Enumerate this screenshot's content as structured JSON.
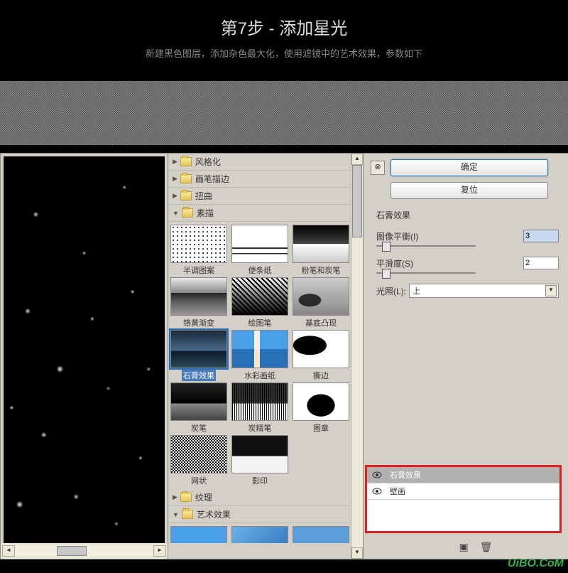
{
  "tutorial": {
    "title": "第7步 - 添加星光",
    "description": "新建黑色图层，添加杂色最大化，使用滤镜中的艺术效果，参数如下"
  },
  "dialog": {
    "ok": "确定",
    "reset": "复位",
    "effect_name": "石膏效果",
    "params": {
      "balance_label": "图像平衡(I)",
      "balance_value": "3",
      "smooth_label": "平滑度(S)",
      "smooth_value": "2",
      "light_label": "光照(L):",
      "light_value": "上"
    }
  },
  "categories": {
    "stylize": "风格化",
    "brush": "画笔描边",
    "distort": "扭曲",
    "sketch": "素描",
    "texture": "纹理",
    "artistic": "艺术效果"
  },
  "thumbs": {
    "halftone": "半调图案",
    "note": "便条纸",
    "chalk": "粉笔和炭笔",
    "chrome": "铬黄渐变",
    "pen": "绘图笔",
    "relief": "基底凸现",
    "plaster": "石膏效果",
    "water": "水彩画纸",
    "torn": "撕边",
    "charcoal": "炭笔",
    "conte": "炭精笔",
    "stamp": "图章",
    "reticulation": "网状",
    "photocopy": "影印"
  },
  "layers": {
    "item1": "石膏效果",
    "item2": "壁画"
  },
  "watermark": "UiBO.CoM"
}
